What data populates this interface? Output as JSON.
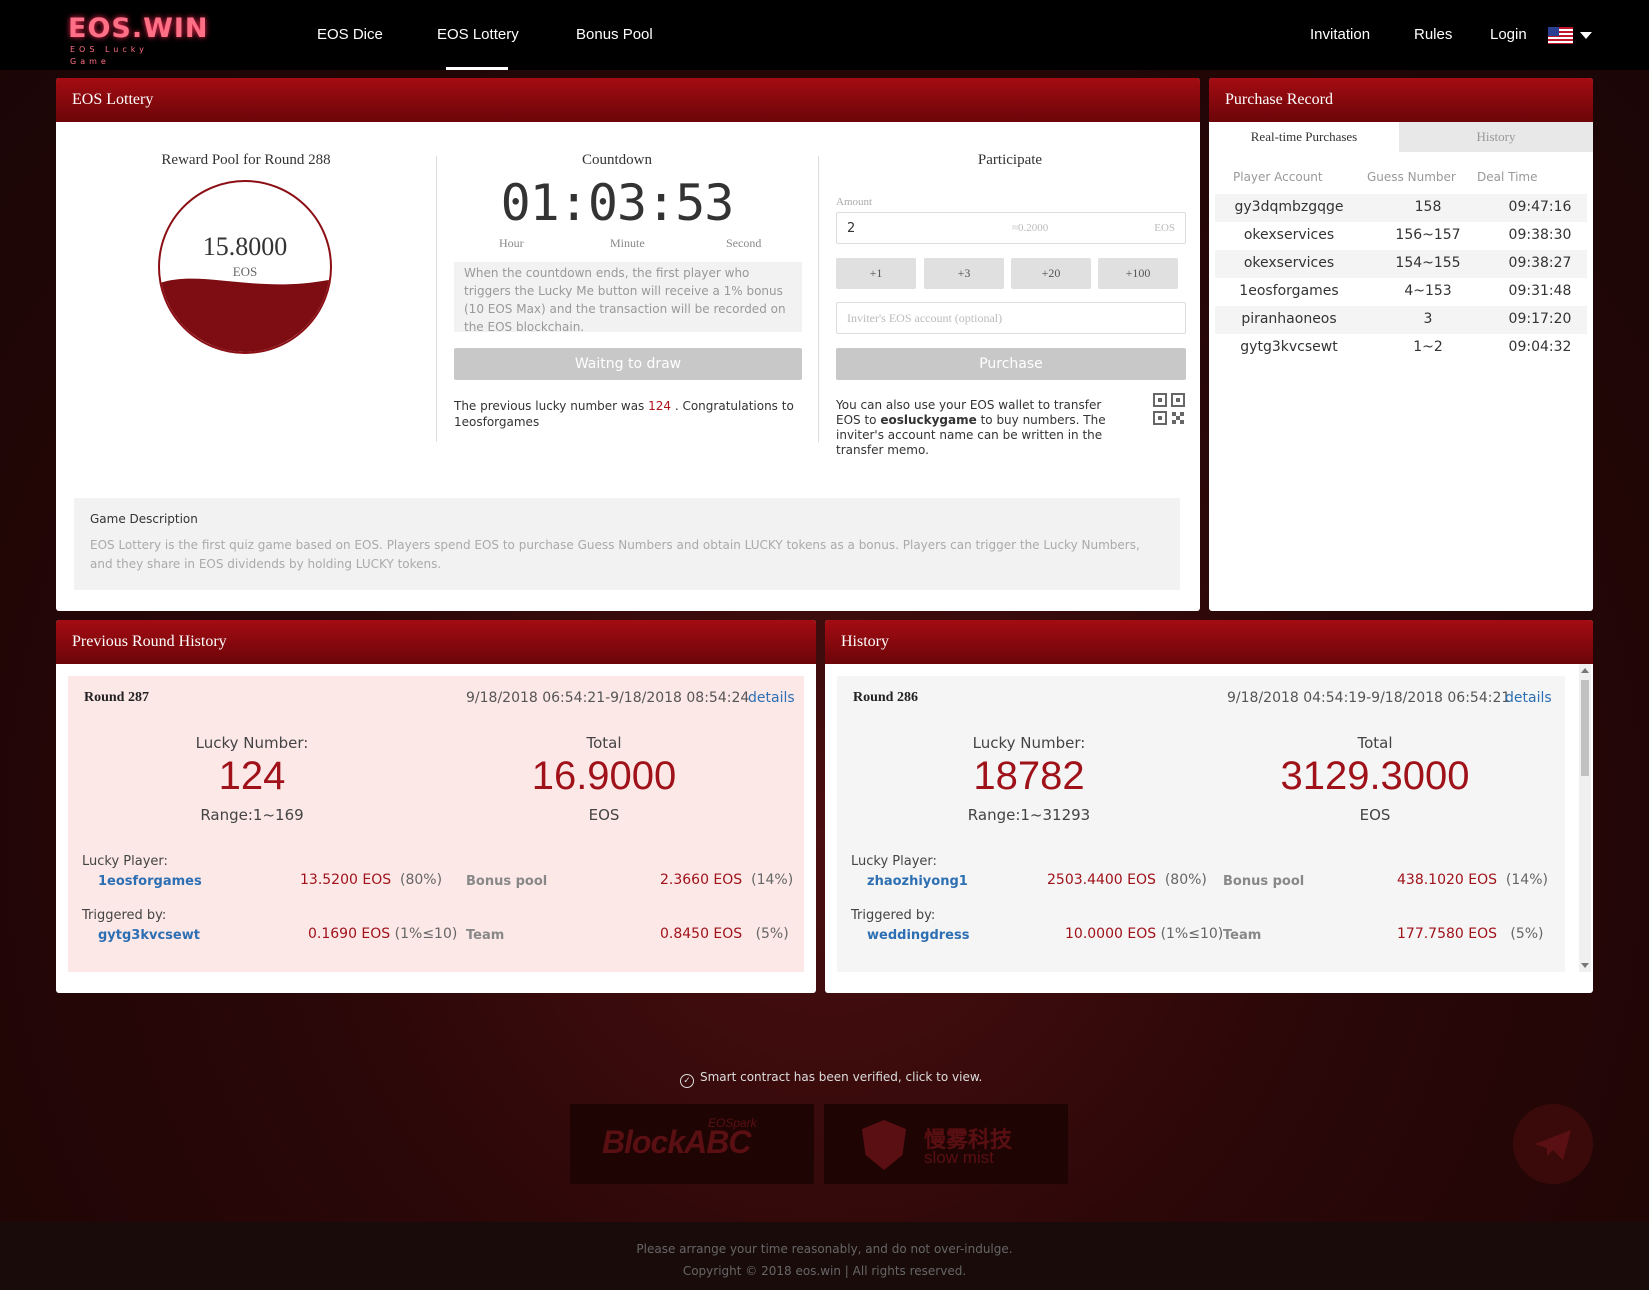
{
  "brand": {
    "logo_main": "EOS.WIN",
    "logo_sub": "EOS Lucky Game"
  },
  "nav": {
    "items": [
      "EOS Dice",
      "EOS Lottery",
      "Bonus Pool"
    ],
    "active": "EOS Lottery",
    "right": [
      "Invitation",
      "Rules",
      "Login"
    ],
    "language_flag": "us-flag-icon"
  },
  "lottery": {
    "title": "EOS Lottery",
    "pool": {
      "title": "Reward Pool for Round 288",
      "amount": "15.8000",
      "unit": "EOS",
      "fill_fraction": 0.42
    },
    "countdown": {
      "title": "Countdown",
      "time": "01:03:53",
      "labels": {
        "hour": "Hour",
        "minute": "Minute",
        "second": "Second"
      },
      "notice": "When the countdown ends, the first player who triggers the Lucky Me button will receive a 1% bonus (10 EOS Max) and the transaction will be recorded on the EOS blockchain.",
      "draw_button": "Waitng to draw",
      "prev_prefix": "The previous lucky number was ",
      "prev_number": "124",
      "prev_suffix": " . Congratulations to",
      "prev_winner": "1eosforgames"
    },
    "participate": {
      "title": "Participate",
      "amount_label": "Amount",
      "amount_value": "2",
      "approx": "≈0.2000",
      "unit": "EOS",
      "increments": [
        "+1",
        "+3",
        "+20",
        "+100"
      ],
      "inviter_placeholder": "Inviter's EOS account (optional)",
      "purchase_button": "Purchase",
      "wallet_prefix": "You can also use your EOS wallet to transfer EOS to ",
      "wallet_account": "eosluckygame",
      "wallet_suffix": " to buy numbers. The inviter's account name can be written in the transfer memo."
    },
    "description": {
      "title": "Game Description",
      "text": "EOS Lottery is the first quiz game based on EOS. Players spend EOS to purchase Guess Numbers and obtain LUCKY tokens as a bonus. Players can trigger the Lucky Numbers, and they share in EOS dividends by holding LUCKY tokens."
    }
  },
  "purchase_record": {
    "title": "Purchase Record",
    "tabs": [
      "Real-time Purchases",
      "History"
    ],
    "headers": [
      "Player Account",
      "Guess Number",
      "Deal Time"
    ],
    "rows": [
      [
        "gy3dqmbzgqge",
        "158",
        "09:47:16"
      ],
      [
        "okexservices",
        "156~157",
        "09:38:30"
      ],
      [
        "okexservices",
        "154~155",
        "09:38:27"
      ],
      [
        "1eosforgames",
        "4~153",
        "09:31:48"
      ],
      [
        "piranhaoneos",
        "3",
        "09:17:20"
      ],
      [
        "gytg3kvcsewt",
        "1~2",
        "09:04:32"
      ]
    ]
  },
  "previous_round": {
    "title": "Previous Round History",
    "round": "Round 287",
    "time_range": "9/18/2018 06:54:21-9/18/2018 08:54:24",
    "details": "details",
    "lucky_label": "Lucky Number:",
    "lucky_number": "124",
    "range": "Range:1~169",
    "total_label": "Total",
    "total": "16.9000",
    "total_unit": "EOS",
    "lucky_player_label": "Lucky Player:",
    "lucky_player": "1eosforgames",
    "lucky_player_amount": "13.5200 EOS",
    "lucky_player_pct": "(80%)",
    "triggered_label": "Triggered by:",
    "triggered": "gytg3kvcsewt",
    "triggered_amount": "0.1690 EOS",
    "triggered_pct": "(1%≤10)",
    "bonus_label": "Bonus pool",
    "bonus_amount": "2.3660 EOS",
    "bonus_pct": "(14%)",
    "team_label": "Team",
    "team_amount": "0.8450 EOS",
    "team_pct": "(5%)"
  },
  "history": {
    "title": "History",
    "round": "Round 286",
    "time_range": "9/18/2018 04:54:19-9/18/2018 06:54:21",
    "details": "details",
    "lucky_label": "Lucky Number:",
    "lucky_number": "18782",
    "range": "Range:1~31293",
    "total_label": "Total",
    "total": "3129.3000",
    "total_unit": "EOS",
    "lucky_player_label": "Lucky Player:",
    "lucky_player": "zhaozhiyong1",
    "lucky_player_amount": "2503.4400 EOS",
    "lucky_player_pct": "(80%)",
    "triggered_label": "Triggered by:",
    "triggered": "weddingdress",
    "triggered_amount": "10.0000 EOS",
    "triggered_pct": "(1%≤10)",
    "bonus_label": "Bonus pool",
    "bonus_amount": "438.1020 EOS",
    "bonus_pct": "(14%)",
    "team_label": "Team",
    "team_amount": "177.7580 EOS",
    "team_pct": "(5%)"
  },
  "footer": {
    "verified": "Smart contract has been verified, click to view.",
    "partners": {
      "blockabc": "BlockABC",
      "eospark": "EOSpark",
      "slowmist_cn": "慢雾科技",
      "slowmist_en": "slow mist"
    },
    "line1": "Please arrange your time reasonably, and do not over-indulge.",
    "line2": "Copyright © 2018 eos.win | All rights reserved."
  },
  "colors": {
    "accent": "#a40c12",
    "lucky_red": "#a0121a",
    "link": "#2d6fb3"
  }
}
